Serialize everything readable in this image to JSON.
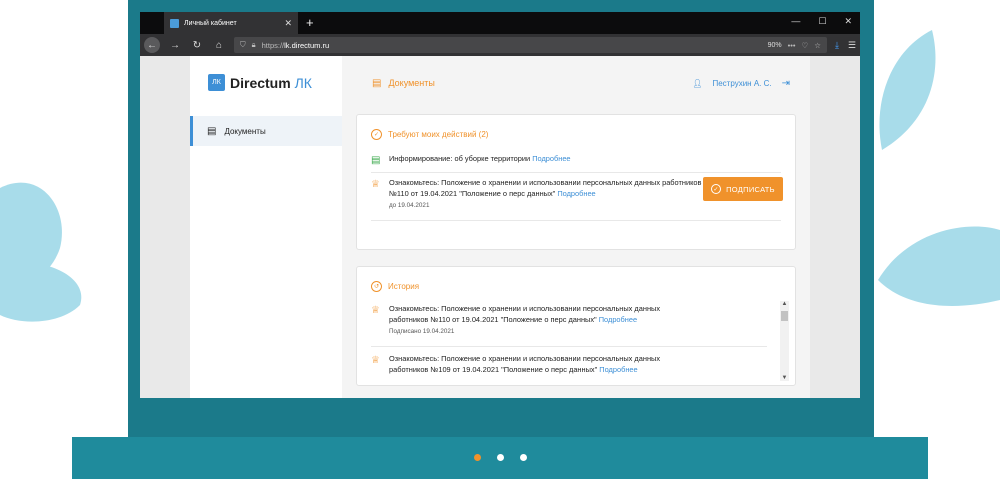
{
  "browser": {
    "tab_title": "Личный кабинет",
    "url_prefix": "https://",
    "url_domain": "lk.directum.ru",
    "zoom": "90%"
  },
  "sidebar": {
    "logo_main": "Directum",
    "logo_suffix": "ЛК",
    "logo_mark": "ЛК",
    "items": [
      {
        "label": "Документы"
      }
    ]
  },
  "header": {
    "title": "Документы",
    "user": "Пеструхин А. С."
  },
  "pending": {
    "title": "Требуют моих действий (2)",
    "items": [
      {
        "text": "Информирование: об уборке территории",
        "link": "Подробнее"
      },
      {
        "text": "Ознакомьтесь: Положение о хранении и использовании персональных данных работников №110 от 19.04.2021 \"Положение о перс данных\"",
        "link": "Подробнее",
        "sub": "до 19.04.2021",
        "action": "ПОДПИСАТЬ"
      }
    ]
  },
  "history": {
    "title": "История",
    "items": [
      {
        "text": "Ознакомьтесь: Положение о хранении и использовании персональных данных работников №110 от 19.04.2021 \"Положение о перс данных\"",
        "link": "Подробнее",
        "sub": "Подписано 19.04.2021"
      },
      {
        "text": "Ознакомьтесь: Положение о хранении и использовании персональных данных работников №109 от 19.04.2021 \"Положение о перс данных\"",
        "link": "Подробнее"
      }
    ]
  },
  "colors": {
    "accent": "#f0922b",
    "link": "#3d8fd6",
    "frame": "#1b7a8a"
  }
}
